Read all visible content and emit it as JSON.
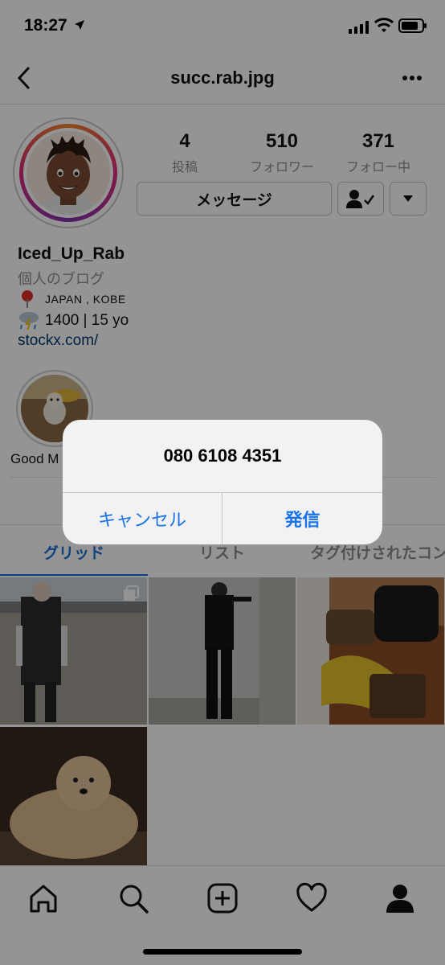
{
  "status_bar": {
    "time": "18:27"
  },
  "nav": {
    "title": "succ.rab.jpg"
  },
  "stats": [
    {
      "value": "4",
      "label": "投稿"
    },
    {
      "value": "510",
      "label": "フォロワー"
    },
    {
      "value": "371",
      "label": "フォロー中"
    }
  ],
  "actions": {
    "message_label": "メッセージ"
  },
  "profile": {
    "name": "Iced_Up_Rab",
    "category": "個人のブログ",
    "location": "JAPAN , KOBE",
    "info": "1400 | 15 yo",
    "website": "stockx.com/"
  },
  "highlight": {
    "label": "Good M"
  },
  "tabs": {
    "grid": "グリッド",
    "list": "リスト",
    "tagged": "タグ付けされたコン"
  },
  "alert": {
    "title": "080 6108 4351",
    "cancel_label": "キャンセル",
    "call_label": "発信"
  },
  "colors": {
    "accent": "#1a73e8",
    "link": "#00376b",
    "dim": "rgba(0,0,0,0.42)"
  }
}
